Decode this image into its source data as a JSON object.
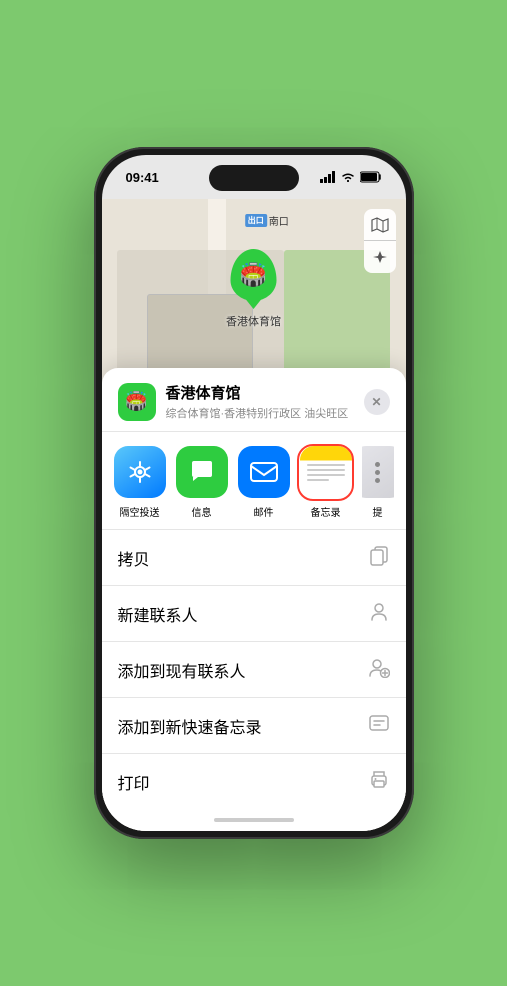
{
  "status_bar": {
    "time": "09:41",
    "signal_bars": 4,
    "wifi": true,
    "battery": "full"
  },
  "map": {
    "label_box": "出口",
    "label_text": "南口",
    "venue_name": "香港体育馆",
    "venue_desc": "综合体育馆·香港特别行政区 油尖旺区"
  },
  "share_actions": [
    {
      "id": "airdrop",
      "label": "隔空投送",
      "icon_type": "airdrop"
    },
    {
      "id": "messages",
      "label": "信息",
      "icon_type": "messages"
    },
    {
      "id": "mail",
      "label": "邮件",
      "icon_type": "mail"
    },
    {
      "id": "notes",
      "label": "备忘录",
      "icon_type": "notes"
    },
    {
      "id": "more",
      "label": "提",
      "icon_type": "more"
    }
  ],
  "action_list": [
    {
      "id": "copy",
      "label": "拷贝",
      "icon": "📋"
    },
    {
      "id": "new-contact",
      "label": "新建联系人",
      "icon": "👤"
    },
    {
      "id": "add-existing",
      "label": "添加到现有联系人",
      "icon": "👤"
    },
    {
      "id": "add-note",
      "label": "添加到新快速备忘录",
      "icon": "📝"
    },
    {
      "id": "print",
      "label": "打印",
      "icon": "🖨️"
    }
  ],
  "close_button": "✕"
}
